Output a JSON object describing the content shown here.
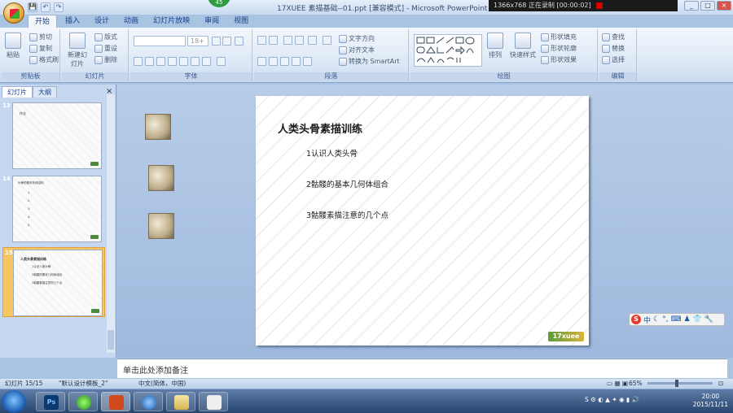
{
  "window": {
    "title": "17XUEE 素描基础--01.ppt [兼容模式] - Microsoft PowerPoint",
    "badge": "45",
    "recorder": "1366x768    正在录制 [00:00:02]"
  },
  "qat": {
    "save": "💾",
    "undo": "↶",
    "redo": "↷"
  },
  "tabs": [
    "开始",
    "插入",
    "设计",
    "动画",
    "幻灯片放映",
    "审阅",
    "视图"
  ],
  "ribbon": {
    "clipboard": {
      "paste": "粘贴",
      "cut": "剪切",
      "copy": "复制",
      "format_painter": "格式刷",
      "label": "剪贴板"
    },
    "slides": {
      "new_slide": "新建幻灯片",
      "layout": "版式",
      "reset": "重设",
      "delete": "删除",
      "label": "幻灯片"
    },
    "font": {
      "size": "18+",
      "label": "字体"
    },
    "paragraph": {
      "text_direction": "文字方向",
      "align_text": "对齐文本",
      "smartart": "转换为 SmartArt",
      "label": "段落"
    },
    "drawing": {
      "arrange": "排列",
      "quick_styles": "快速样式",
      "shape_fill": "形状填充",
      "shape_outline": "形状轮廓",
      "shape_effects": "形状效果",
      "label": "绘图"
    },
    "editing": {
      "find": "查找",
      "replace": "替换",
      "select": "选择",
      "label": "编辑"
    }
  },
  "pane": {
    "tab_slides": "幻灯片",
    "tab_outline": "大纲",
    "close": "×"
  },
  "thumbnails": [
    {
      "num": "13",
      "title": "作业",
      "lines": []
    },
    {
      "num": "14",
      "title": "头骨的基本形体结构",
      "lines": [
        "1.",
        "2.",
        "3.",
        "4.",
        "5."
      ]
    },
    {
      "num": "15",
      "title": "人类头骨素描训练",
      "lines": [
        "1认识人类头骨",
        "2骷髅的基本几何体组合",
        "3骷髅素描注意的几个点"
      ]
    }
  ],
  "slide": {
    "title": "人类头骨素描训练",
    "bullets": [
      "1认识人类头骨",
      "2骷髅的基本几何体组合",
      "3骷髅素描注意的几个点"
    ],
    "logo": "17xuee"
  },
  "sogou": {
    "label": "中"
  },
  "notes": {
    "placeholder": "单击此处添加备注"
  },
  "status": {
    "slide": "幻灯片 15/15",
    "theme": "\"默认设计模板_2\"",
    "lang": "中文(简体，中国)",
    "zoom": "65%"
  },
  "tray": {
    "time": "20:00",
    "date": "2015/11/11"
  }
}
